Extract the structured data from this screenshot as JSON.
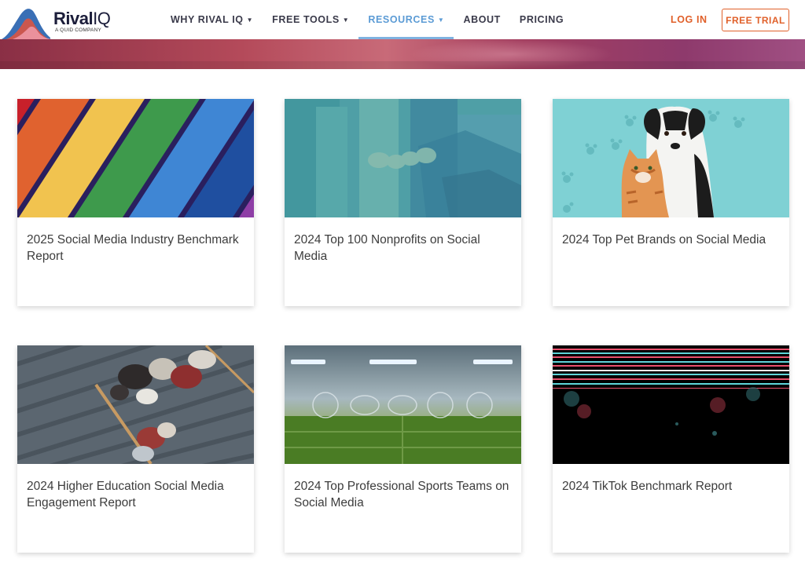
{
  "header": {
    "brand_bold": "Rival",
    "brand_light": "IQ",
    "brand_tagline": "A QUID COMPANY",
    "nav": [
      {
        "label": "WHY RIVAL IQ",
        "caret": "▼",
        "active": false
      },
      {
        "label": "FREE TOOLS",
        "caret": "▼",
        "active": false
      },
      {
        "label": "RESOURCES",
        "caret": "▼",
        "active": true
      },
      {
        "label": "ABOUT",
        "caret": "",
        "active": false
      },
      {
        "label": "PRICING",
        "caret": "",
        "active": false
      }
    ],
    "login_label": "LOG IN",
    "trial_label": "FREE TRIAL"
  },
  "colors": {
    "accent_orange": "#e0602a",
    "active_blue": "#5b9bd5",
    "brand_navy": "#1b1d3a"
  },
  "cards": [
    {
      "title": "2025 Social Media Industry Benchmark Report",
      "image": "rainbow-stripes"
    },
    {
      "title": "2024 Top 100 Nonprofits on Social Media",
      "image": "hands-teal"
    },
    {
      "title": "2024 Top Pet Brands on Social Media",
      "image": "dog-and-cat"
    },
    {
      "title": "2024 Higher Education Social Media Engagement Report",
      "image": "students-on-stairs"
    },
    {
      "title": "2024 Top Professional Sports Teams on Social Media",
      "image": "sports-stadium"
    },
    {
      "title": "2024 TikTok Benchmark Report",
      "image": "tiktok-glitch"
    }
  ]
}
